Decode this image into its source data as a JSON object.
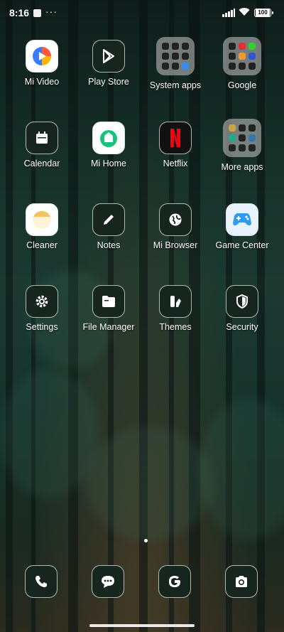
{
  "status_bar": {
    "time": "8:16",
    "more": "···",
    "battery": "100"
  },
  "apps": [
    {
      "label": "Mi Video"
    },
    {
      "label": "Play Store"
    },
    {
      "label": "System apps"
    },
    {
      "label": "Google"
    },
    {
      "label": "Calendar"
    },
    {
      "label": "Mi Home"
    },
    {
      "label": "Netflix"
    },
    {
      "label": "More apps"
    },
    {
      "label": "Cleaner"
    },
    {
      "label": "Notes"
    },
    {
      "label": "Mi Browser"
    },
    {
      "label": "Game Center"
    },
    {
      "label": "Settings"
    },
    {
      "label": "File Manager"
    },
    {
      "label": "Themes"
    },
    {
      "label": "Security"
    }
  ],
  "dock": [
    "phone",
    "messages",
    "google",
    "camera"
  ]
}
